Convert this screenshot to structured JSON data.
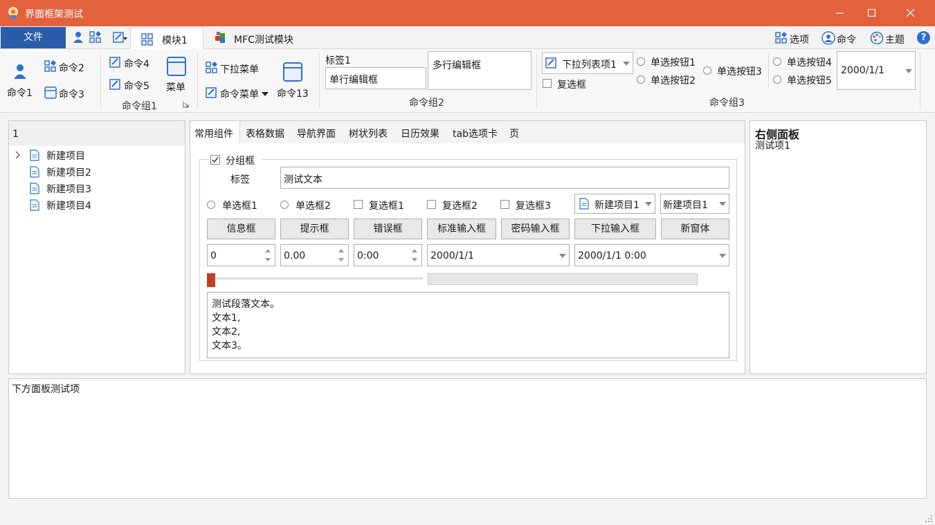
{
  "window": {
    "title": "界面框架测试"
  },
  "ribbon_tabs": {
    "file": "文件",
    "module1": "模块1",
    "mfc": "MFC测试模块"
  },
  "ribbon_right": {
    "options": "选项",
    "command": "命令",
    "theme": "主题",
    "help": "?"
  },
  "ribbon": {
    "cmd1": "命令1",
    "cmd2": "命令2",
    "cmd3": "命令3",
    "cmd4": "命令4",
    "cmd5": "命令5",
    "menu": "菜单",
    "group1": "命令组1",
    "dropdown_menu": "下拉菜单",
    "cmd_menu": "命令菜单",
    "cmd13": "命令13",
    "label1": "标签1",
    "single_edit": "单行编辑框",
    "multi_edit": "多行编辑框",
    "group2": "命令组2",
    "list_item1": "下拉列表项1",
    "checkbox": "复选框",
    "radio1": "单选按钮1",
    "radio2": "单选按钮2",
    "radio3": "单选按钮3",
    "radio4": "单选按钮4",
    "radio5": "单选按钮5",
    "date": "2000/1/1",
    "group3": "命令组3"
  },
  "left_tree": {
    "header": "1",
    "items": [
      "新建项目",
      "新建项目2",
      "新建项目3",
      "新建项目4"
    ]
  },
  "center_tabs": [
    "常用组件",
    "表格数据",
    "导航界面",
    "树状列表",
    "日历效果",
    "tab选项卡",
    "页"
  ],
  "center": {
    "groupbox": "分组框",
    "label": "标签",
    "text_value": "测试文本",
    "radio1": "单选框1",
    "radio2": "单选框2",
    "check1": "复选框1",
    "check2": "复选框2",
    "check3": "复选框3",
    "combo1": "新建项目1",
    "combo2": "新建项目1",
    "buttons": [
      "信息框",
      "提示框",
      "错误框",
      "标准输入框",
      "密码输入框",
      "下拉输入框",
      "新窗体"
    ],
    "spin_int": "0",
    "spin_float": "0.00",
    "time": "0:00",
    "date": "2000/1/1",
    "datetime": "2000/1/1 0:00",
    "slider_value": 0,
    "progress_value": 0,
    "paragraph": [
      "测试段落文本。",
      "文本1,",
      "文本2,",
      "文本3。"
    ]
  },
  "right_panel": {
    "title": "右侧面板",
    "item1": "测试项1"
  },
  "bottom_panel": {
    "text": "下方面板测试项"
  },
  "colors": {
    "titlebar": "#e2623e",
    "file_tab": "#2a5caa",
    "slider_thumb": "#c0401f",
    "icon_blue": "#2d6fd0"
  }
}
